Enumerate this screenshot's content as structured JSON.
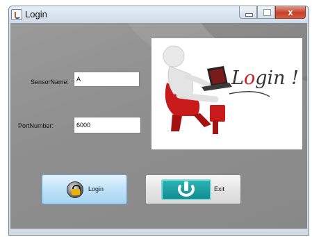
{
  "window": {
    "title": "Login",
    "close_glyph": "x"
  },
  "form": {
    "sensor_name_label": "SensorName:",
    "sensor_name_value": "A",
    "port_number_label": "PortNumber:",
    "port_number_value": "6000"
  },
  "image": {
    "caption_prefix": "L",
    "caption_o": "o",
    "caption_suffix": "gin !"
  },
  "buttons": {
    "login_label": "Login",
    "exit_label": "Exit"
  },
  "icons": {
    "app": "java-cup-icon",
    "login": "lock-icon",
    "exit": "power-icon"
  },
  "colors": {
    "content_bg": "#8f8f8f",
    "login_button": "#bfe2f8",
    "exit_icon": "#0e8a8f",
    "close_button": "#c4402a"
  }
}
